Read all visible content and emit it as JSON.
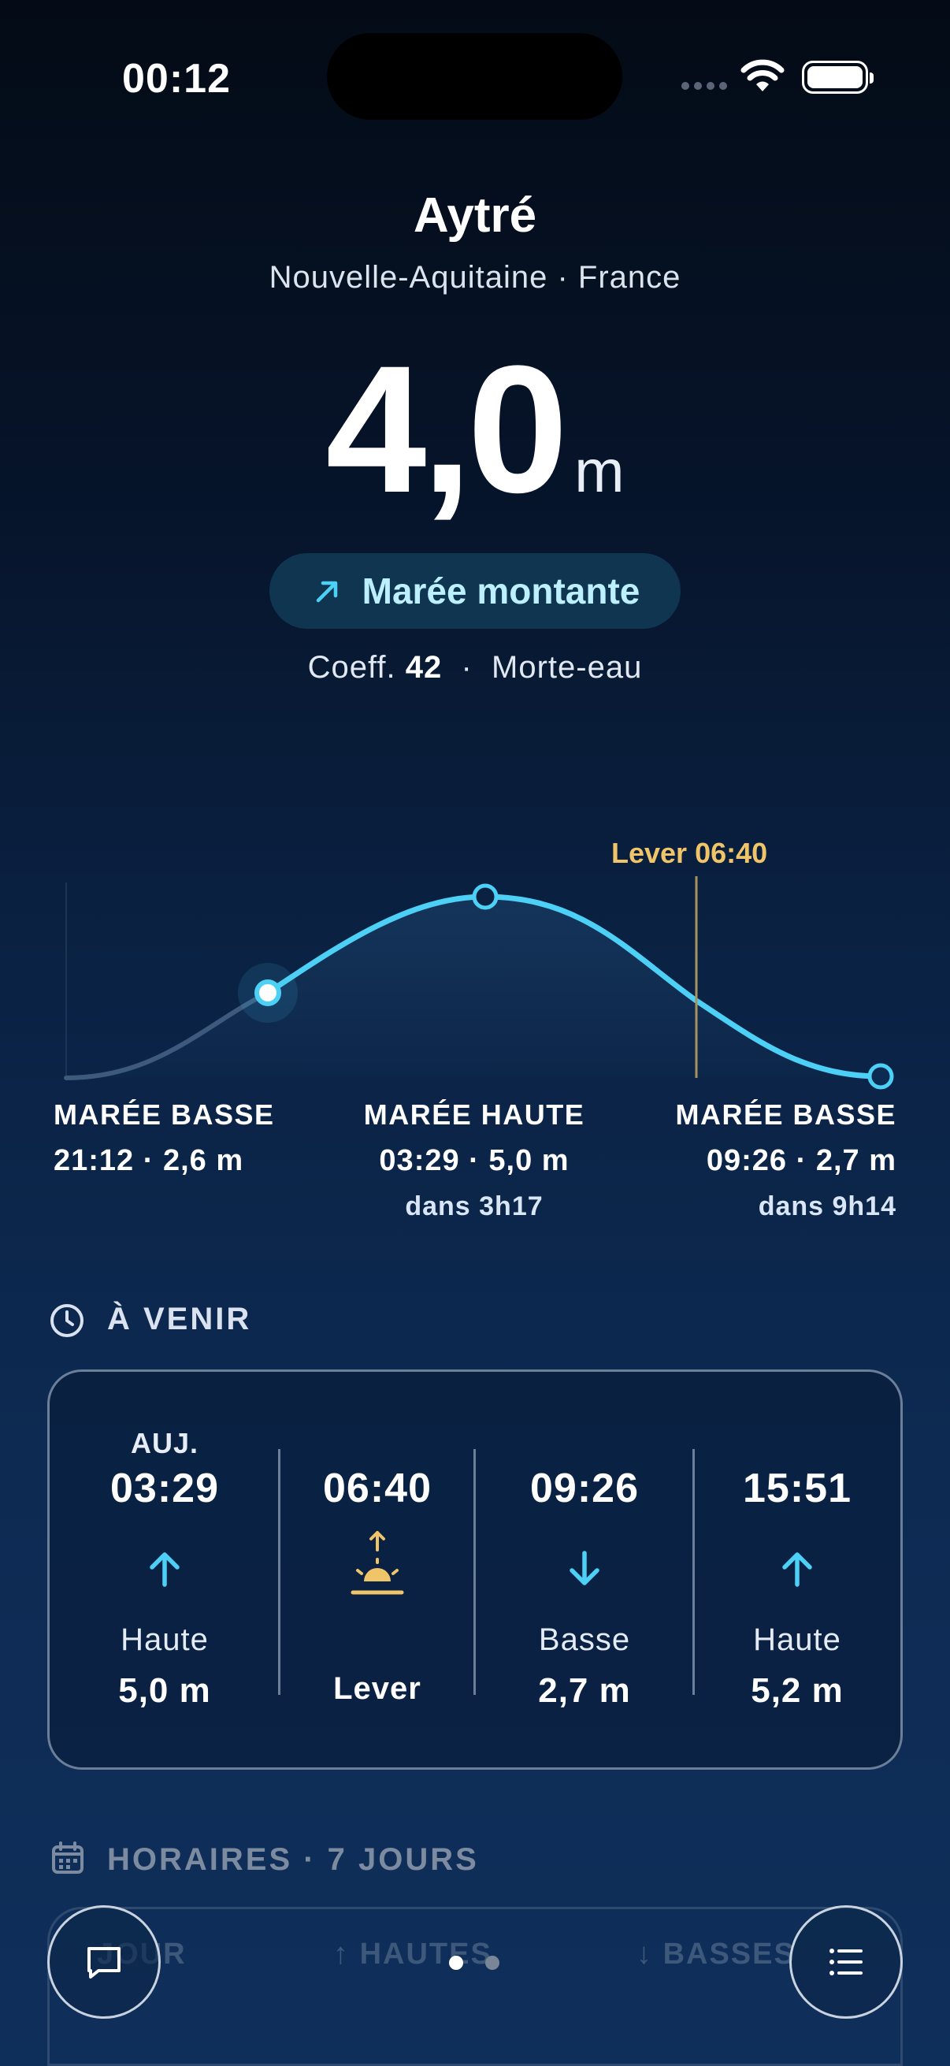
{
  "status_bar": {
    "time": "00:12"
  },
  "location": {
    "city": "Aytré",
    "region": "Nouvelle-Aquitaine · France"
  },
  "current": {
    "height": "4,0",
    "unit": "m",
    "trend": "Marée montante",
    "coeff_label": "Coeff.",
    "coeff_value": "42",
    "separator": "·",
    "period": "Morte-eau"
  },
  "chart_labels": {
    "sunrise": "Lever 06:40",
    "points": [
      {
        "title": "MARÉE BASSE",
        "value": "21:12 · 2,6 m",
        "until": ""
      },
      {
        "title": "MARÉE HAUTE",
        "value": "03:29 · 5,0 m",
        "until": "dans 3h17"
      },
      {
        "title": "MARÉE BASSE",
        "value": "09:26 · 2,7 m",
        "until": "dans 9h14"
      }
    ]
  },
  "upcoming": {
    "title": "À VENIR",
    "items": [
      {
        "day": "AUJ.",
        "time": "03:29",
        "icon": "arrow-up-icon",
        "kind": "Haute",
        "height": "5,0 m"
      },
      {
        "day": "",
        "time": "06:40",
        "icon": "sunrise-icon",
        "kind": "",
        "height": "Lever"
      },
      {
        "day": "",
        "time": "09:26",
        "icon": "arrow-down-icon",
        "kind": "Basse",
        "height": "2,7 m"
      },
      {
        "day": "",
        "time": "15:51",
        "icon": "arrow-up-icon",
        "kind": "Haute",
        "height": "5,2 m"
      }
    ]
  },
  "schedule": {
    "title": "HORAIRES · 7 JOURS",
    "col_day": "JOUR",
    "col_high": "HAUTES",
    "col_low": "BASSES"
  },
  "colors": {
    "accent": "#4dd0f5",
    "sunrise": "#f0c56a",
    "background": "#0a2142"
  }
}
